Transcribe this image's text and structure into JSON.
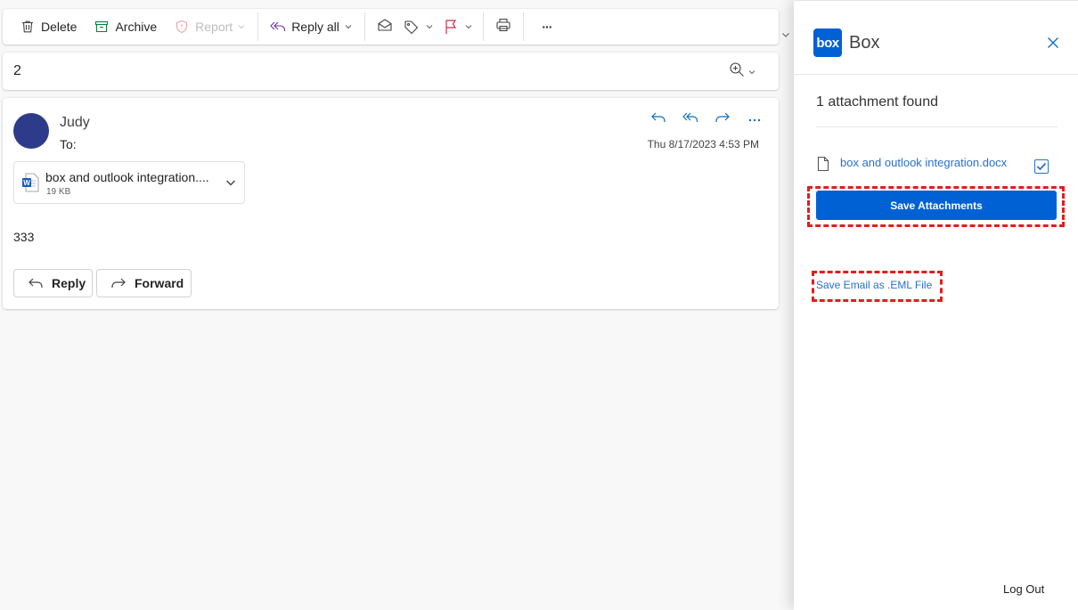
{
  "toolbar": {
    "delete_label": "Delete",
    "archive_label": "Archive",
    "report_label": "Report",
    "reply_all_label": "Reply all",
    "more_label": "···"
  },
  "subject": {
    "text": "2"
  },
  "message": {
    "sender": "Judy",
    "to_label": "To:",
    "timestamp": "Thu 8/17/2023 4:53 PM",
    "attachment": {
      "name": "box and outlook integration....",
      "size": "19 KB"
    },
    "body": "333",
    "reply_label": "Reply",
    "forward_label": "Forward"
  },
  "box_panel": {
    "logo_text": "box",
    "title": "Box",
    "found_text": "1 attachment found",
    "file_name": "box and outlook integration.docx",
    "file_checked": true,
    "save_attachments_label": "Save Attachments",
    "save_eml_label": "Save Email as .EML File",
    "logout_label": "Log Out"
  },
  "colors": {
    "box_blue": "#0061d5",
    "avatar": "#2e3b8a",
    "link_blue": "#2a6fc9",
    "highlight_red": "#e01e1e",
    "flag_red": "#c4314b"
  }
}
